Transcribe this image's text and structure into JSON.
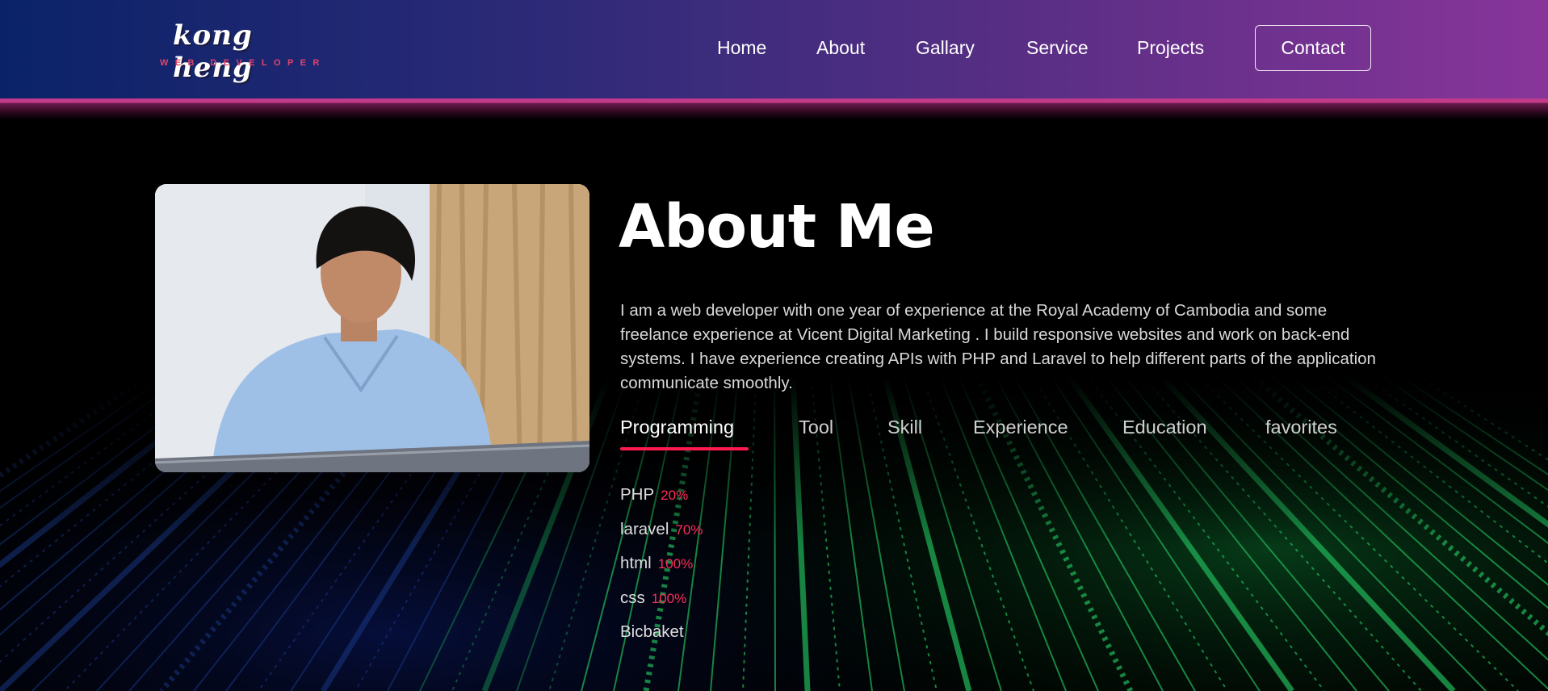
{
  "header": {
    "logo_name": "kong heng",
    "logo_subtitle": "WEB DEVELOPER",
    "nav": [
      "Home",
      "About",
      "Gallary",
      "Service",
      "Projects"
    ],
    "contact_label": "Contact"
  },
  "about": {
    "title": "About Me",
    "description": "I am a web developer with one year of experience at the Royal Academy of Cambodia and some freelance experience at Vicent Digital Marketing . I build responsive websites and work on back-end systems. I have experience creating APIs with PHP and Laravel to help different parts of the application communicate smoothly.",
    "tabs": [
      "Programming",
      "Tool",
      "Skill",
      "Experience",
      "Education",
      "favorites"
    ],
    "active_tab": "Programming",
    "skills": [
      {
        "name": "PHP",
        "percent": "20%"
      },
      {
        "name": "laravel",
        "percent": "70%"
      },
      {
        "name": "html",
        "percent": "100%"
      },
      {
        "name": "css",
        "percent": "100%"
      },
      {
        "name": "Bicbaket",
        "percent": ""
      }
    ]
  },
  "colors": {
    "accent": "#ff1a4f",
    "header_start": "#0a2368",
    "header_end": "#88359a",
    "matrix_green": "#22c55e"
  }
}
